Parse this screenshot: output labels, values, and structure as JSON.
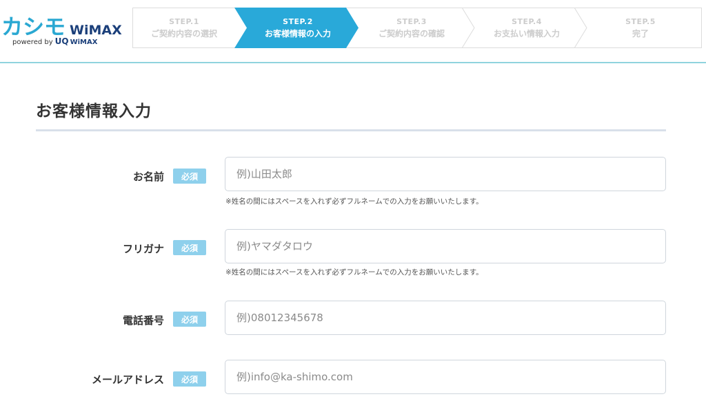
{
  "brand": {
    "name": "カシモ",
    "wimax": "WiMAX",
    "powered_by": "powered by",
    "uq": "UQ",
    "uq_wimax": "WiMAX"
  },
  "steps": [
    {
      "num": "STEP.1",
      "label": "ご契約内容の選択",
      "active": false
    },
    {
      "num": "STEP.2",
      "label": "お客様情報の入力",
      "active": true
    },
    {
      "num": "STEP.3",
      "label": "ご契約内容の確認",
      "active": false
    },
    {
      "num": "STEP.4",
      "label": "お支払い情報入力",
      "active": false
    },
    {
      "num": "STEP.5",
      "label": "完了",
      "active": false
    }
  ],
  "colors": {
    "active_step": "#29a9d9",
    "required_badge": "#8ed0ec",
    "header_rule": "#8fd3de"
  },
  "page": {
    "title": "お客様情報入力"
  },
  "form": {
    "required_label": "必須",
    "fields": [
      {
        "label": "お名前",
        "placeholder": "例)山田太郎",
        "value": "",
        "note": "※姓名の間にはスペースを入れず必ずフルネームでの入力をお願いいたします。"
      },
      {
        "label": "フリガナ",
        "placeholder": "例)ヤマダタロウ",
        "value": "",
        "note": "※姓名の間にはスペースを入れず必ずフルネームでの入力をお願いいたします。"
      },
      {
        "label": "電話番号",
        "placeholder": "例)08012345678",
        "value": ""
      },
      {
        "label": "メールアドレス",
        "placeholder": "例)info@ka-shimo.com",
        "value": ""
      }
    ]
  }
}
